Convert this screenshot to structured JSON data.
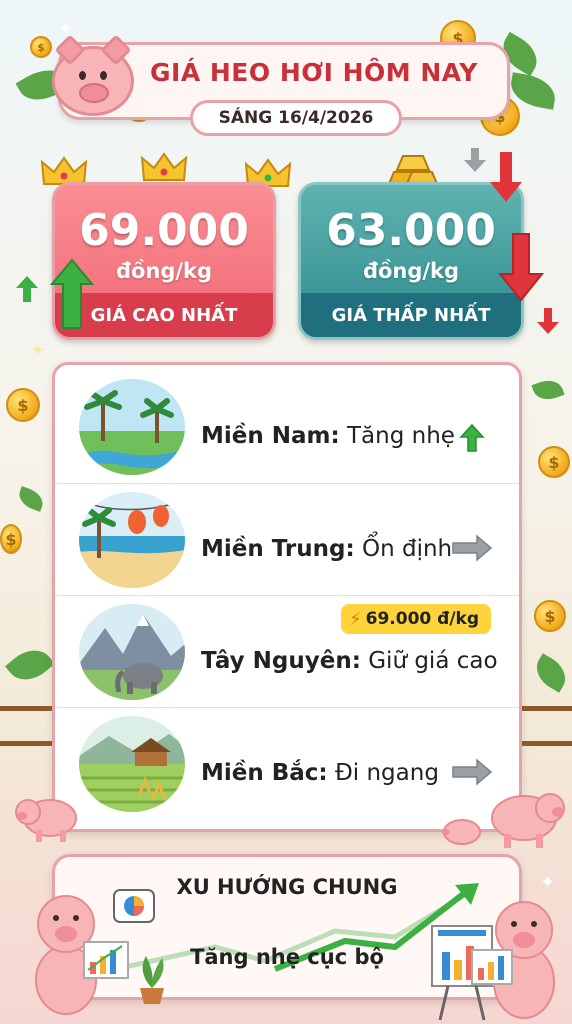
{
  "header": {
    "title": "GIÁ HEO HƠI HÔM NAY",
    "date": "SÁNG 16/4/2026"
  },
  "prices": {
    "high": {
      "value": "69.000",
      "unit": "đồng/kg",
      "label": "GIÁ CAO NHẤT"
    },
    "low": {
      "value": "63.000",
      "unit": "đồng/kg",
      "label": "GIÁ THẤP NHẤT"
    }
  },
  "regions": [
    {
      "name": "Miền Nam:",
      "status": "Tăng nhẹ",
      "trend_icon": "up-arrow-icon"
    },
    {
      "name": "Miền Trung:",
      "status": "Ổn định",
      "trend_icon": "right-arrow-icon"
    },
    {
      "name": "Tây Nguyên:",
      "status": "Giữ giá cao",
      "badge": "69.000 đ/kg",
      "trend_icon": "lightning-icon"
    },
    {
      "name": "Miền Bắc:",
      "status": "Đi ngang",
      "trend_icon": "right-arrow-icon"
    }
  ],
  "trend": {
    "title": "XU HƯỚNG CHUNG",
    "text": "Tăng nhẹ cục bộ"
  },
  "colors": {
    "accent_red": "#c8303a",
    "high_card": "#f06a77",
    "low_card": "#2f8b8d",
    "up_green": "#3cb043",
    "down_red": "#e0353a",
    "badge_yellow": "#ffd33b"
  }
}
